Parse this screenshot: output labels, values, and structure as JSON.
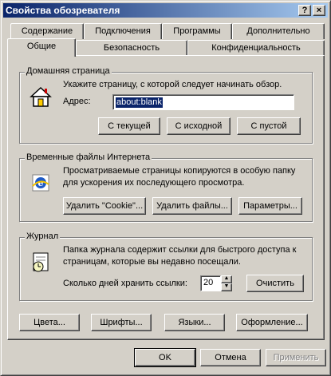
{
  "window": {
    "title": "Свойства обозревателя",
    "help_label": "?",
    "close_label": "×"
  },
  "tabs": {
    "row_back": [
      "Содержание",
      "Подключения",
      "Программы",
      "Дополнительно"
    ],
    "row_front": [
      "Общие",
      "Безопасность",
      "Конфиденциальность"
    ],
    "active": "Общие"
  },
  "home": {
    "title": "Домашняя страница",
    "description": "Укажите страницу, с которой следует начинать обзор.",
    "address_label": "Адрес:",
    "address_value": "about:blank",
    "btn_current": "С текущей",
    "btn_default": "С исходной",
    "btn_blank": "С пустой"
  },
  "temp": {
    "title": "Временные файлы Интернета",
    "description": "Просматриваемые страницы копируются в особую папку для ускорения их последующего просмотра.",
    "btn_cookies": "Удалить \"Cookie\"...",
    "btn_files": "Удалить файлы...",
    "btn_settings": "Параметры..."
  },
  "history": {
    "title": "Журнал",
    "description": "Папка журнала содержит ссылки для быстрого доступа к страницам, которые вы недавно посещали.",
    "days_label": "Сколько дней хранить ссылки:",
    "days_value": "20",
    "btn_clear": "Очистить"
  },
  "bottom_buttons": {
    "colors": "Цвета...",
    "fonts": "Шрифты...",
    "languages": "Языки...",
    "accessibility": "Оформление..."
  },
  "dialog_buttons": {
    "ok": "OK",
    "cancel": "Отмена",
    "apply": "Применить"
  },
  "colors": {
    "titlebar_start": "#0a246a",
    "titlebar_end": "#a6caf0",
    "face": "#d4d0c8",
    "selection": "#0a246a"
  }
}
